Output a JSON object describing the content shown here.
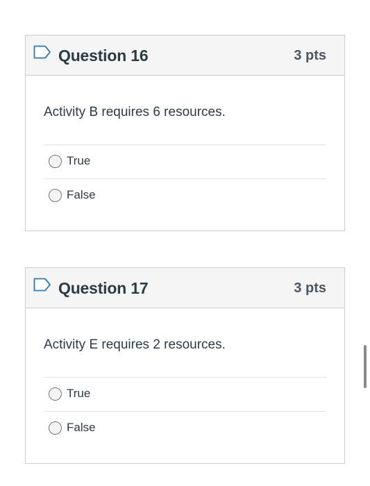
{
  "questions": [
    {
      "title": "Question 16",
      "points": "3 pts",
      "text": "Activity B requires 6 resources.",
      "options": [
        "True",
        "False"
      ]
    },
    {
      "title": "Question 17",
      "points": "3 pts",
      "text": "Activity E requires 2 resources.",
      "options": [
        "True",
        "False"
      ]
    }
  ],
  "icons": {
    "flag": "bookmark-flag-icon",
    "radio": "radio-unchecked-icon"
  },
  "colors": {
    "header_bg": "#f5f5f5",
    "border": "#c7cdd1",
    "flag": "#2b7abc",
    "text": "#2d3b45"
  }
}
